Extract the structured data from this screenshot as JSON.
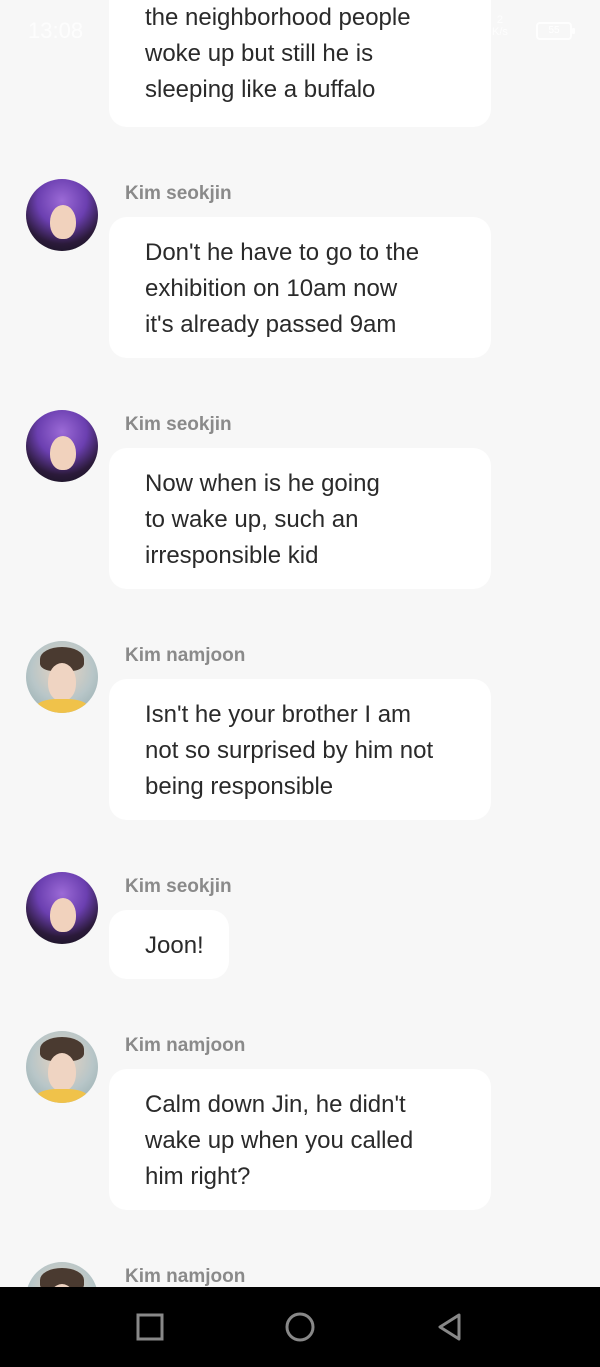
{
  "status_bar": {
    "time": "13:08",
    "speed": "2\nK/s",
    "battery": "55"
  },
  "top_message": {
    "lines": [
      "the neighborhood people",
      "woke up but still he is",
      "sleeping like a buffalo"
    ]
  },
  "messages": [
    {
      "sender": "Kim seokjin",
      "avatar": "jin",
      "lines": [
        "Don't he have to go to the",
        "exhibition on 10am now",
        "it's already passed 9am"
      ]
    },
    {
      "sender": "Kim seokjin",
      "avatar": "jin",
      "lines": [
        "Now when is he going",
        "to wake up, such an",
        "irresponsible kid"
      ]
    },
    {
      "sender": "Kim namjoon",
      "avatar": "joon",
      "lines": [
        "Isn't he your brother I am",
        "not so surprised by him not",
        "being responsible"
      ]
    },
    {
      "sender": "Kim seokjin",
      "avatar": "jin",
      "lines": [
        "Joon!"
      ]
    },
    {
      "sender": "Kim namjoon",
      "avatar": "joon",
      "lines": [
        "Calm down Jin, he didn't",
        "wake up when you called",
        "him right?"
      ]
    },
    {
      "sender": "Kim namjoon",
      "avatar": "joon",
      "lines": []
    }
  ],
  "nav": {
    "recent_icon": "square-icon",
    "home_icon": "circle-icon",
    "back_icon": "triangle-back-icon"
  }
}
